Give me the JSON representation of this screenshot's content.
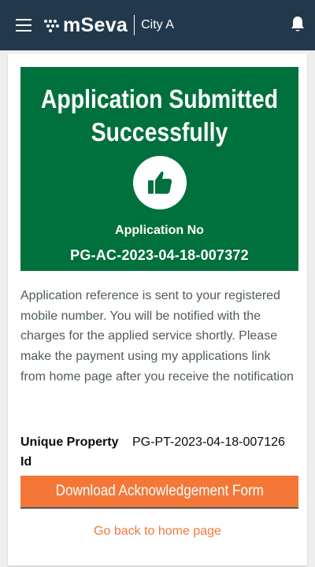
{
  "header": {
    "brand": "mSeva",
    "city": "City A",
    "icons": {
      "menu": "hamburger-menu-icon",
      "notifications": "bell-icon"
    },
    "colors": {
      "background": "#22394d"
    }
  },
  "banner": {
    "title": "Application Submitted Successfully",
    "icon": "thumbs-up-icon",
    "application_no_label": "Application No",
    "application_no": "PG-AC-2023-04-18-007372",
    "colors": {
      "background": "#00703c"
    }
  },
  "message": "Application reference is sent to your registered mobile number. You will be notified with the charges for the applied service shortly. Please make the payment using my applications link from home page after you receive the notification",
  "property": {
    "label": "Unique Property Id",
    "value": "PG-PT-2023-04-18-007126"
  },
  "actions": {
    "download_label": "Download Acknowledgement Form",
    "home_link_label": "Go back to home page",
    "colors": {
      "accent": "#f47738"
    }
  }
}
